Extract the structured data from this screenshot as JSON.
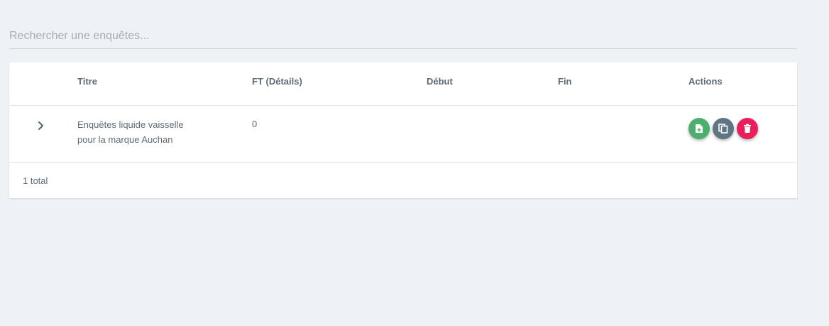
{
  "search": {
    "placeholder": "Rechercher une enquêtes...",
    "value": ""
  },
  "table": {
    "columns": [
      "Titre",
      "FT (Détails)",
      "Début",
      "Fin",
      "Actions"
    ],
    "rows": [
      {
        "title_line1": "Enquêtes liquide vaisselle",
        "title_line2": "pour la marque Auchan",
        "ft": "0",
        "debut": "",
        "fin": ""
      }
    ]
  },
  "footer": {
    "total": "1 total"
  },
  "icons": {
    "expand": "chevron-right-icon",
    "add_document": "add-document-icon",
    "copy": "copy-icon",
    "delete": "trash-icon"
  },
  "colors": {
    "background": "#eef2f7",
    "add_button": "#4caf6e",
    "copy_button": "#5f7584",
    "delete_button": "#e91e5a",
    "text": "#5e6b75"
  }
}
